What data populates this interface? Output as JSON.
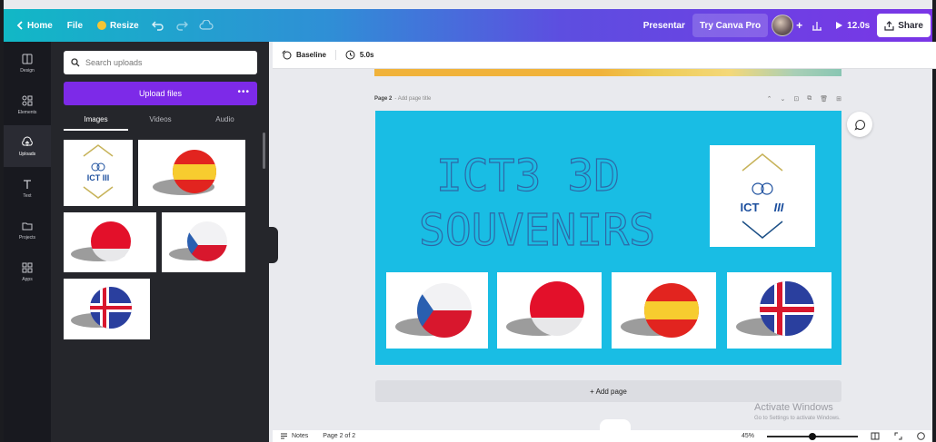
{
  "topbar": {
    "home": "Home",
    "file": "File",
    "resize": "Resize",
    "present": "Presentar",
    "try_pro": "Try Canva Pro",
    "play_label": "12.0s",
    "share": "Share"
  },
  "rail": {
    "items": [
      {
        "label": "Design",
        "icon": "layout-icon"
      },
      {
        "label": "Elements",
        "icon": "shapes-icon"
      },
      {
        "label": "Uploads",
        "icon": "cloud-upload-icon"
      },
      {
        "label": "Text",
        "icon": "text-icon"
      },
      {
        "label": "Projects",
        "icon": "folder-icon"
      },
      {
        "label": "Apps",
        "icon": "grid-icon"
      }
    ]
  },
  "panel": {
    "search_placeholder": "Search uploads",
    "upload_button": "Upload files",
    "more": "•••",
    "tabs": [
      "Images",
      "Videos",
      "Audio"
    ],
    "active_tab": "Images"
  },
  "toolbar": {
    "animate": "Baseline",
    "duration": "5.0s"
  },
  "page": {
    "label": "Page 2",
    "title_placeholder": "- Add page title",
    "heading_line1": "ICT3 3D",
    "heading_line2": "SOUVENIRS",
    "logo_text": "ICT",
    "logo_mark": "III",
    "add_page": "+ Add page"
  },
  "bottombar": {
    "notes": "Notes",
    "page_indicator": "Page 2 of 2",
    "zoom": "45%"
  },
  "watermark": {
    "title": "Activate Windows",
    "subtitle": "Go to Settings to activate Windows."
  },
  "colors": {
    "topbar_start": "#11b8c6",
    "topbar_end": "#7a35e6",
    "page_bg": "#19bde4",
    "upload_button": "#7d2ae8",
    "panel_bg": "#25262b"
  },
  "flags": [
    "czech-flag-ball",
    "red-ball",
    "spain-flag-ball",
    "iceland-flag-ball"
  ]
}
